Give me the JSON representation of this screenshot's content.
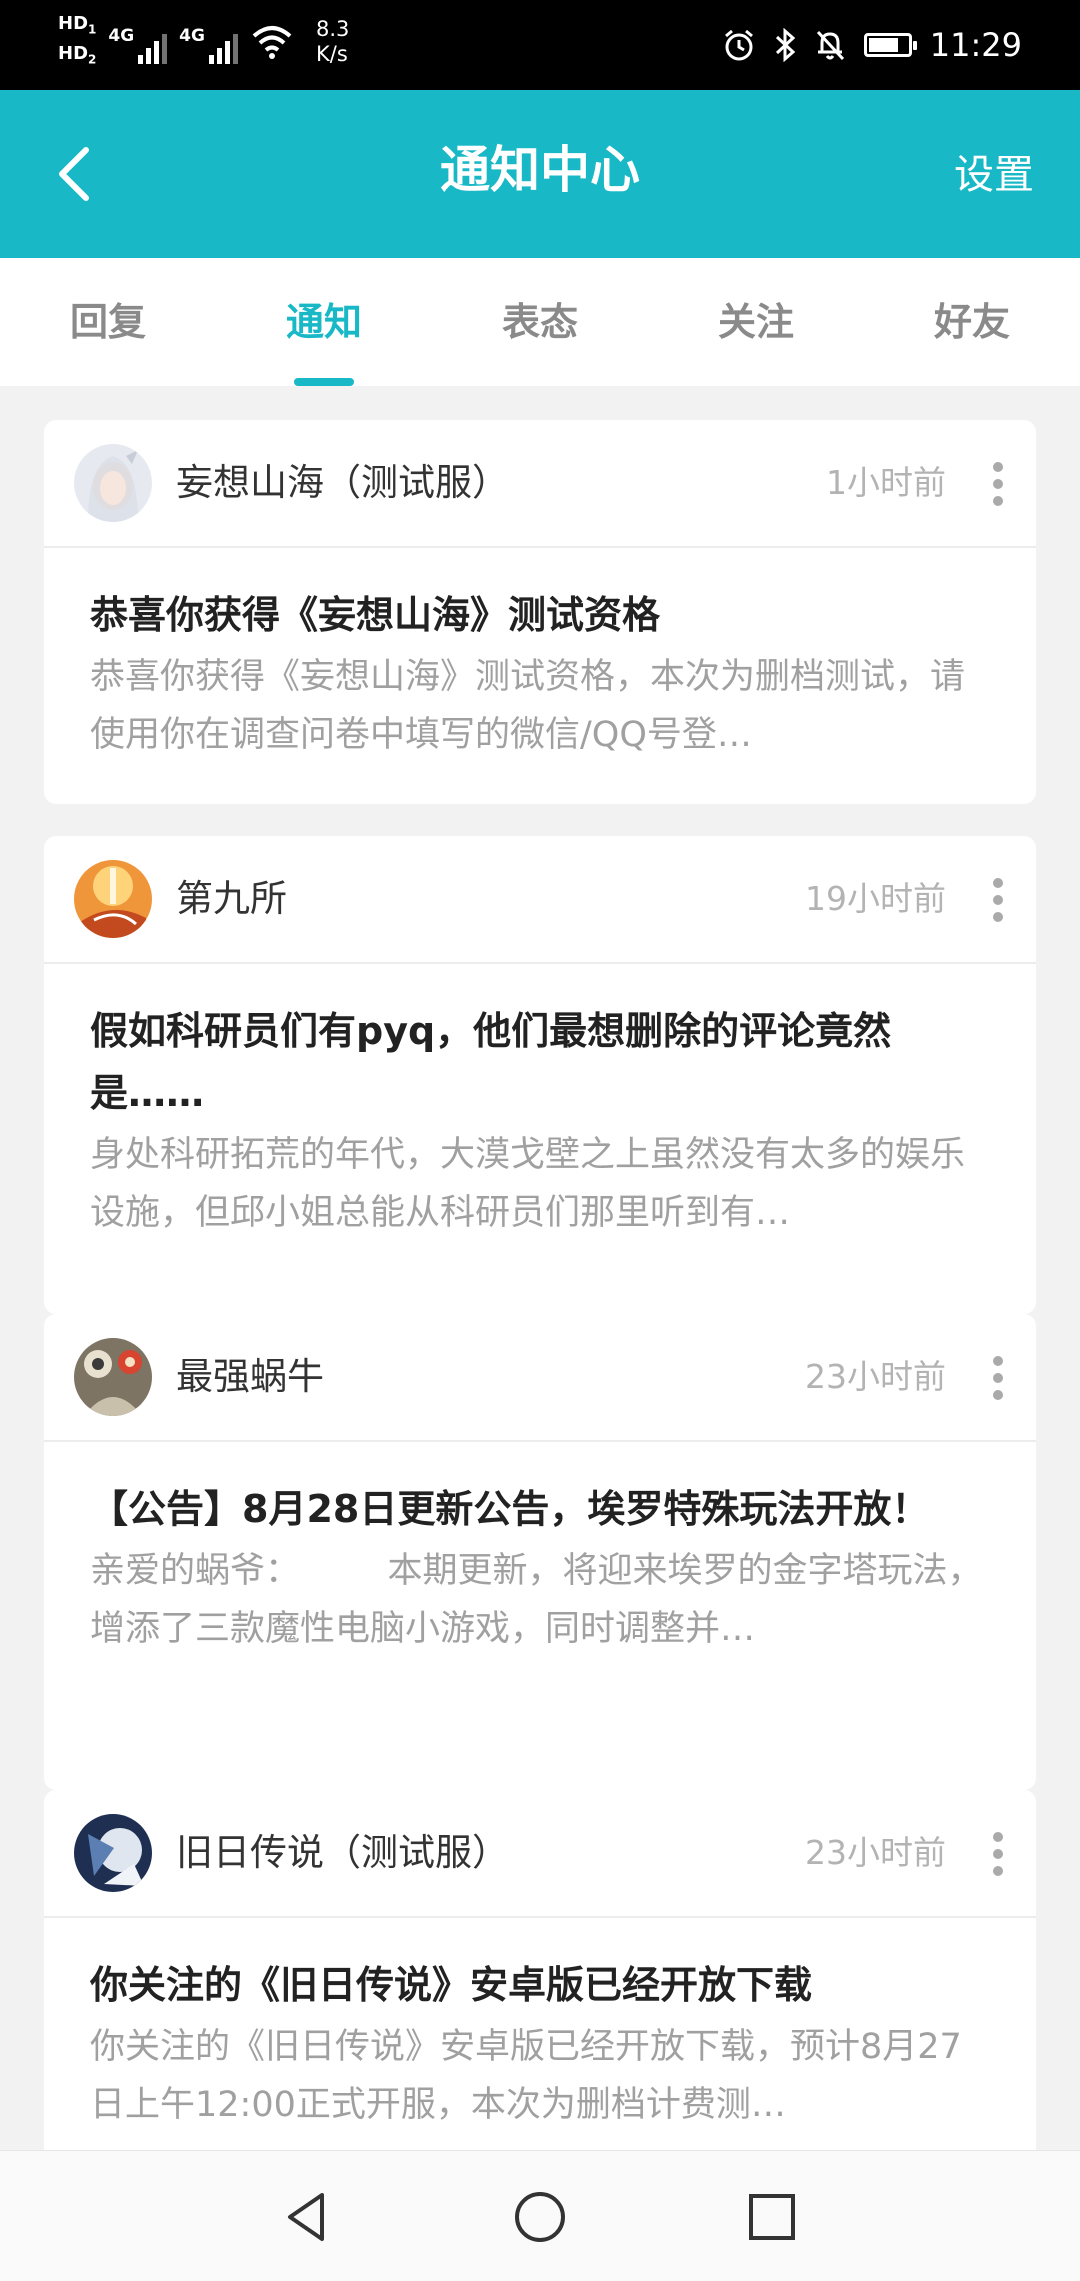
{
  "status_bar": {
    "hd1": "HD",
    "hd1_sub": "1",
    "hd2": "HD",
    "hd2_sub": "2",
    "net1": "4G",
    "net2": "4G",
    "speed_value": "8.3",
    "speed_unit": "K/s",
    "time": "11:29",
    "battery_level": 0.75
  },
  "header": {
    "title": "通知中心",
    "settings_label": "设置",
    "back_icon": "chevron-left-icon"
  },
  "tabs": [
    {
      "label": "回复",
      "active": false
    },
    {
      "label": "通知",
      "active": true
    },
    {
      "label": "表态",
      "active": false
    },
    {
      "label": "关注",
      "active": false
    },
    {
      "label": "好友",
      "active": false
    }
  ],
  "notifications": [
    {
      "sender": "妄想山海（测试服）",
      "time": "1小时前",
      "title": "恭喜你获得《妄想山海》测试资格",
      "summary": "恭喜你获得《妄想山海》测试资格，本次为删档测试，请使用你在调查问卷中填写的微信/QQ号登…"
    },
    {
      "sender": "第九所",
      "time": "19小时前",
      "title": "假如科研员们有pyq，他们最想删除的评论竟然是……",
      "summary": "身处科研拓荒的年代，大漠戈壁之上虽然没有太多的娱乐设施，但邱小姐总能从科研员们那里听到有…"
    },
    {
      "sender": "最强蜗牛",
      "time": "23小时前",
      "title": "【公告】8月28日更新公告，埃罗特殊玩法开放！",
      "summary": "亲爱的蜗爷：　　　本期更新，将迎来埃罗的金字塔玩法，增添了三款魔性电脑小游戏，同时调整并…"
    },
    {
      "sender": "旧日传说（测试服）",
      "time": "23小时前",
      "title": "你关注的《旧日传说》安卓版已经开放下载",
      "summary": "你关注的《旧日传说》安卓版已经开放下载，预计8月27日上午12:00正式开服，本次为删档计费测…"
    }
  ],
  "nav_bar": {
    "back": "triangle-back-icon",
    "home": "circle-home-icon",
    "recents": "square-recents-icon"
  },
  "colors": {
    "accent": "#18b8c6",
    "background": "#f2f2f2"
  }
}
